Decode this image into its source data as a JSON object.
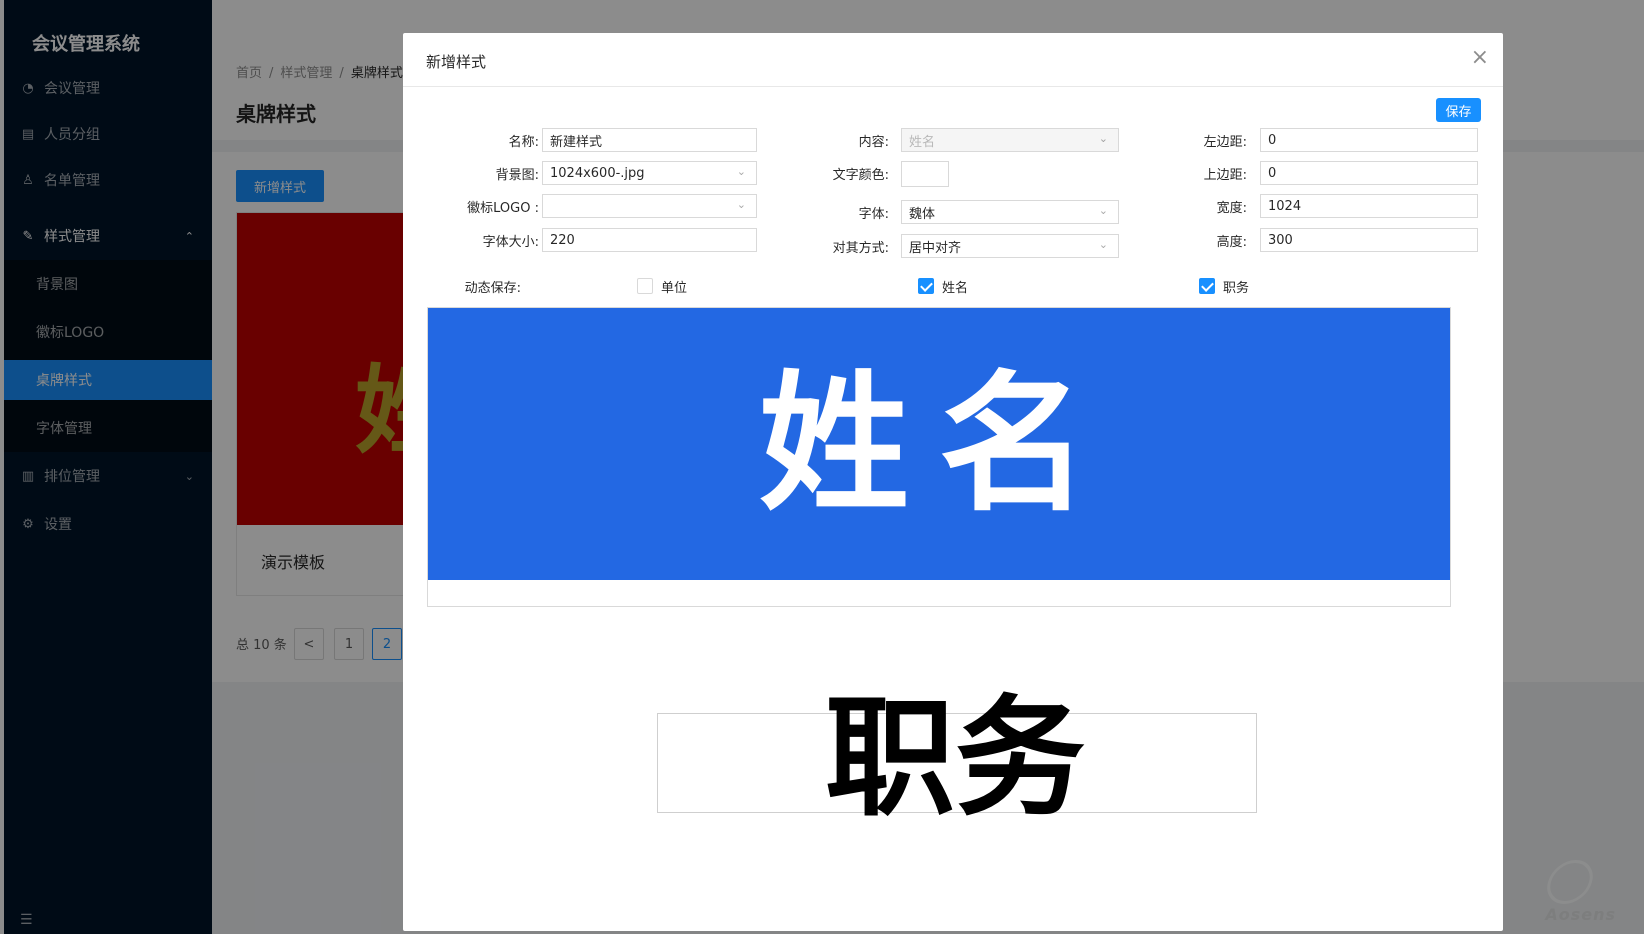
{
  "app": {
    "title": "会议管理系统"
  },
  "sidebar": {
    "items": [
      {
        "label": "会议管理",
        "icon": "dashboard-icon"
      },
      {
        "label": "人员分组",
        "icon": "table-icon"
      },
      {
        "label": "名单管理",
        "icon": "user-icon"
      },
      {
        "label": "样式管理",
        "icon": "edit-icon"
      },
      {
        "label": "排位管理",
        "icon": "grid-icon"
      },
      {
        "label": "设置",
        "icon": "gear-icon"
      }
    ],
    "sub_items": [
      {
        "label": "背景图"
      },
      {
        "label": "徽标LOGO"
      },
      {
        "label": "桌牌样式",
        "active": true
      },
      {
        "label": "字体管理"
      }
    ]
  },
  "breadcrumb": [
    "首页",
    "样式管理",
    "桌牌样式"
  ],
  "page": {
    "title": "桌牌样式",
    "new_button": "新增样式",
    "card_name": "演示模板",
    "card_cover_text": "姓",
    "pager_total": "总 10 条",
    "pager_prev": "<",
    "pager_pages": [
      "1",
      "2"
    ],
    "pager_current": "2"
  },
  "modal": {
    "title": "新增样式",
    "close": "×",
    "save_button": "保存",
    "fields": {
      "name_label": "名称:",
      "name_value": "新建样式",
      "bg_label": "背景图:",
      "bg_value": "1024x600-.jpg",
      "logo_label": "徽标LOGO :",
      "logo_value": "",
      "font_size_label": "字体大小:",
      "font_size_value": "220",
      "content_label": "内容:",
      "content_value": "姓名",
      "text_color_label": "文字颜色:",
      "font_label": "字体:",
      "font_value": "魏体",
      "align_label": "对其方式:",
      "align_value": "居中对齐",
      "left_margin_label": "左边距:",
      "left_margin_value": "0",
      "top_margin_label": "上边距:",
      "top_margin_value": "0",
      "width_label": "宽度:",
      "width_value": "1024",
      "height_label": "高度:",
      "height_value": "300"
    },
    "dynamic_save_label": "动态保存:",
    "checkboxes": [
      {
        "label": "单位",
        "checked": false
      },
      {
        "label": "姓名",
        "checked": true
      },
      {
        "label": "职务",
        "checked": true
      }
    ],
    "preview": {
      "name_text": "姓名",
      "title_text": "职务",
      "background_color": "#2368e3"
    }
  },
  "watermark": "Aosens",
  "colors": {
    "primary": "#1890ff",
    "sidebar": "#001529",
    "preview_blue": "#2368e3"
  }
}
